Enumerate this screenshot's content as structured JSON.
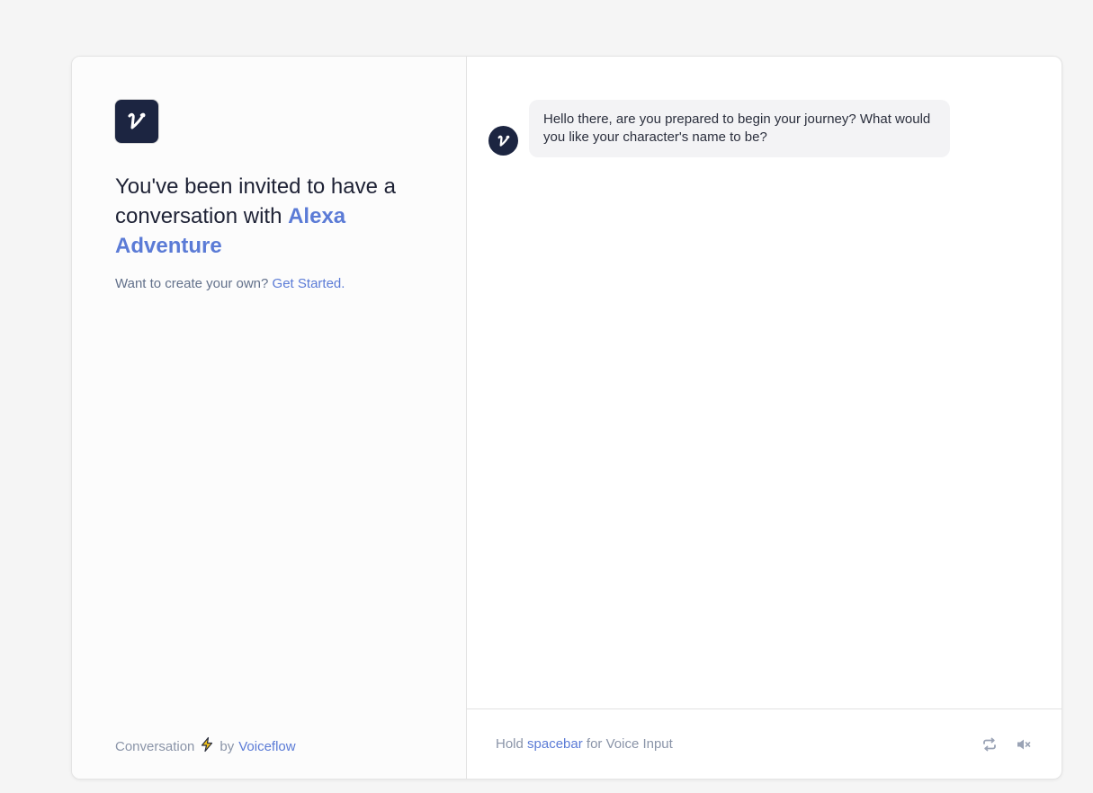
{
  "left_panel": {
    "invite_prefix": "You've been invited to have a conversation with ",
    "project_name": "Alexa Adventure",
    "create_prompt": "Want to create your own?",
    "create_link": "Get Started.",
    "footer_prefix": "Conversation",
    "footer_by": "by",
    "footer_brand": "Voiceflow",
    "logo_icon": "voiceflow-logo-icon",
    "bolt_icon": "lightning-bolt-icon"
  },
  "chat": {
    "messages": [
      {
        "sender": "assistant",
        "text": "Hello there, are you prepared to begin your journey? What would you like your character's name to be?"
      }
    ],
    "footer": {
      "hint_prefix": "Hold",
      "hint_key": "spacebar",
      "hint_suffix": "for Voice Input",
      "restart_icon": "restart-icon",
      "mute_icon": "mute-icon"
    }
  },
  "colors": {
    "accent": "#5b7bd6",
    "brand_dark": "#1c2541",
    "bubble_bg": "#f3f3f5",
    "page_bg": "#f5f5f5",
    "bolt": "#f2c21b"
  }
}
